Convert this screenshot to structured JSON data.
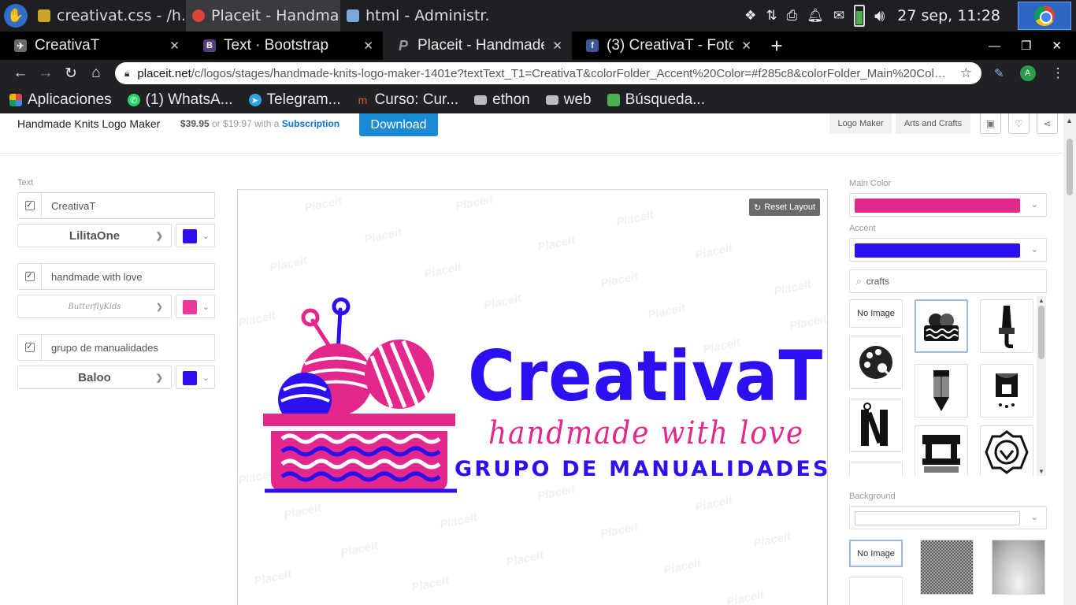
{
  "taskbar": {
    "tasks": [
      {
        "label": "creativat.css - /h...",
        "icon_color": "#c9a227"
      },
      {
        "label": "Placeit - Handma...",
        "icon_color": "#db4437"
      },
      {
        "label": "html - Administr...",
        "icon_color": "#7aa6d8"
      }
    ],
    "clock": "27 sep, 11:28"
  },
  "browser": {
    "tabs": [
      {
        "title": "CreativaT",
        "favicon": "bird-icon",
        "favicon_color": "#6b6b6b",
        "glyph": "✈"
      },
      {
        "title": "Text · Bootstrap",
        "favicon": "bootstrap-icon",
        "favicon_color": "#563d7c",
        "glyph": "B"
      },
      {
        "title": "Placeit - Handmade",
        "favicon": "placeit-icon",
        "favicon_color": "#202124",
        "glyph": "P"
      },
      {
        "title": "(3) CreativaT - Fotos",
        "favicon": "facebook-icon",
        "favicon_color": "#3b5998",
        "glyph": "f"
      }
    ],
    "url_host": "placeit.net",
    "url_path": "/c/logos/stages/handmade-knits-logo-maker-1401e?textText_T1=CreativaT&colorFolder_Accent%20Color=#f285c8&colorFolder_Main%20Color...",
    "profile_initial": "A",
    "bookmarks": [
      {
        "label": "Aplicaciones",
        "icon": "apps-grid-icon",
        "color": "#e8453c"
      },
      {
        "label": "(1) WhatsA...",
        "icon": "whatsapp-icon",
        "color": "#25d366"
      },
      {
        "label": "Telegram...",
        "icon": "telegram-icon",
        "color": "#2ca5e0"
      },
      {
        "label": "Curso: Cur...",
        "icon": "course-icon",
        "color": "#e35b1e"
      },
      {
        "label": "ethon",
        "icon": "folder-icon",
        "color": "#bdbdbd"
      },
      {
        "label": "web",
        "icon": "folder-icon",
        "color": "#bdbdbd"
      },
      {
        "label": "Búsqueda...",
        "icon": "search-bookmark-icon",
        "color": "#4caf50"
      }
    ]
  },
  "product": {
    "name": "Handmade Knits Logo Maker",
    "price": "$39.95",
    "price_alt": "or $19.97 with a",
    "subscription": "Subscription",
    "download": "Download",
    "tags": [
      "Logo Maker",
      "Arts and Crafts"
    ]
  },
  "editor": {
    "section_label": "Text",
    "fields": [
      {
        "value": "CreativaT",
        "font": "LilitaOne",
        "color": "#2b10f0"
      },
      {
        "value": "handmade with love",
        "font": "ButterflyKids",
        "color": "#f0379c"
      },
      {
        "value": "grupo de manualidades",
        "font": "Baloo",
        "color": "#2b10f0"
      }
    ]
  },
  "canvas": {
    "reset_label": "Reset Layout",
    "watermark": "Placeit",
    "logo": {
      "title": "CreativaT",
      "tagline": "handmade with love",
      "subtitle": "GRUPO DE MANUALIDADES",
      "main_color": "#e2288d",
      "accent_color": "#2b10f0"
    }
  },
  "right_panel": {
    "main_color_label": "Main Color",
    "main_color": "#e2288d",
    "accent_label": "Accent",
    "accent_color": "#2b10f0",
    "search_value": "crafts",
    "no_image": "No Image",
    "background_label": "Background",
    "background_no_image": "No Image"
  }
}
